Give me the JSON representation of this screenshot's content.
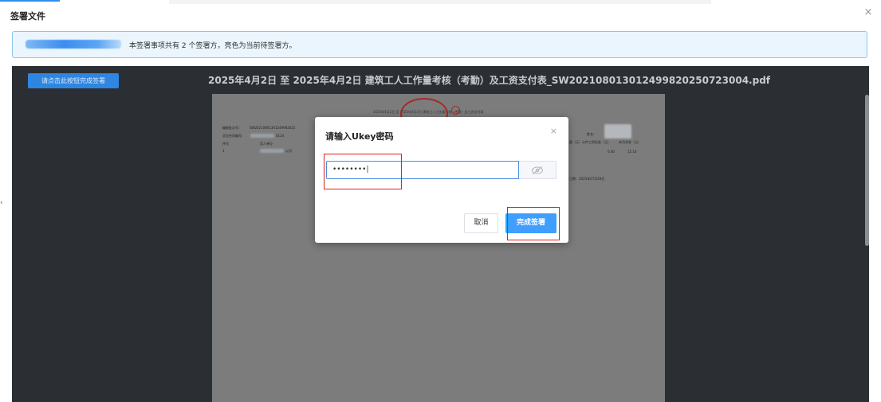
{
  "dialog": {
    "title": "签署文件",
    "close_icon": "×"
  },
  "info_bar": {
    "text": "本签署事项共有 2 个签署方，亮色为当前待签署方。"
  },
  "viewer": {
    "sign_button_label": "请点击此按钮完成签署",
    "pdf_title": "2025年4月2日 至 2025年4月2日 建筑工人工作量考核（考勤）及工资支付表_SW20210801301249982025072300​4.pdf",
    "page": {
      "header_text": "2025年4月2日 至 2025年4月2日 建筑工人工作量考核（考勤）及工资支付表",
      "field1_label": "编制批次号：",
      "field1_value": "SW20210801301249982025",
      "field2_label": "总包合同编号：",
      "field2_value": "0124",
      "col_seq": "序号",
      "col_unit": "用人单位",
      "row_seq": "1",
      "row_unit_suffix": "公司",
      "right_col_name": "姓名：",
      "right_col_calc": "量（元）计件工资标准（元）",
      "right_col_pay": "本月实发（元）",
      "right_val_1": "0.40",
      "right_val_2": "15.10",
      "right_date": "日期：2025年07月28日"
    }
  },
  "modal": {
    "title": "请输入Ukey密码",
    "close_icon": "×",
    "password_value": "••••••••|",
    "eye_icon": "eye-off-icon",
    "cancel_label": "取消",
    "confirm_label": "完成签署"
  },
  "side": {
    "left_arrow": "‹"
  },
  "colors": {
    "accent": "#409eff",
    "viewer_bg": "#2b2f33",
    "annotation_red": "#e02020"
  }
}
